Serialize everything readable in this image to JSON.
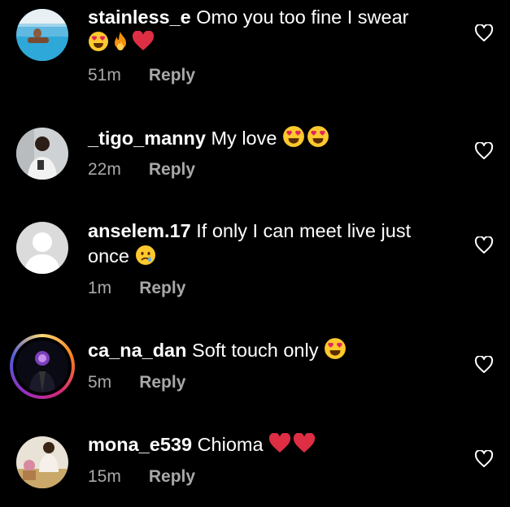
{
  "comments": [
    {
      "username": "stainless_e",
      "text": "Omo you too fine I swear",
      "emojis": [
        "heart-eyes",
        "fire",
        "red-heart"
      ],
      "time": "51m",
      "reply": "Reply"
    },
    {
      "username": "_tigo_manny",
      "text": "My love",
      "emojis": [
        "heart-eyes",
        "heart-eyes"
      ],
      "time": "22m",
      "reply": "Reply"
    },
    {
      "username": "anselem.17",
      "text": "If only I can meet live just once",
      "emojis": [
        "crying-face"
      ],
      "time": "1m",
      "reply": "Reply"
    },
    {
      "username": "ca_na_dan",
      "text": "Soft touch only",
      "emojis": [
        "heart-eyes"
      ],
      "time": "5m",
      "reply": "Reply"
    },
    {
      "username": "mona_e539",
      "text": "Chioma",
      "emojis": [
        "red-heart",
        "red-heart"
      ],
      "time": "15m",
      "reply": "Reply"
    }
  ],
  "colors": {
    "background": "#000000",
    "text": "#ffffff",
    "meta": "#a8a8a8"
  },
  "icons": {
    "like": "heart-outline-icon"
  }
}
